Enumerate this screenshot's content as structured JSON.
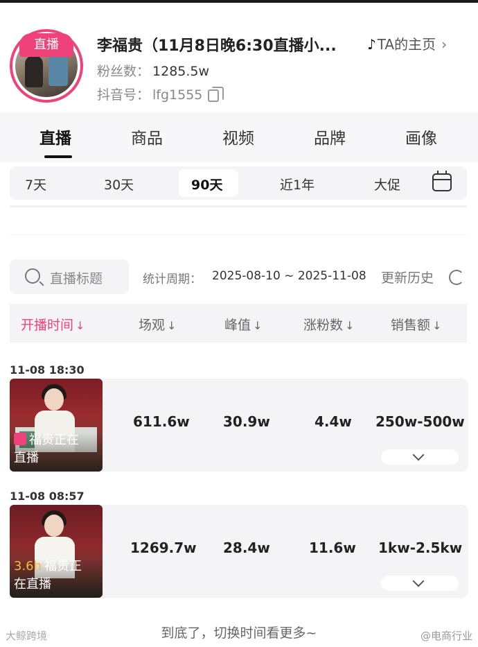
{
  "profile": {
    "live_badge": "直播",
    "name": "李福贵（11月8日晚6:30直播小...",
    "homepage_label": "TA的主页",
    "fans_label": "粉丝数：",
    "fans_value": "1285.5w",
    "douyin_id_label": "抖音号：",
    "douyin_id_value": "lfg1555"
  },
  "tabs": [
    "直播",
    "商品",
    "视频",
    "品牌",
    "画像"
  ],
  "active_tab": "直播",
  "periods": [
    "7天",
    "30天",
    "90天",
    "近1年",
    "大促"
  ],
  "active_period": "90天",
  "search": {
    "placeholder": "直播标题"
  },
  "stat": {
    "label": "统计周期：",
    "range": "2025-08-10 ~ 2025-11-08",
    "history": "更新历史"
  },
  "columns": [
    "开播时间",
    "场观",
    "峰值",
    "涨粉数",
    "销售额"
  ],
  "sort_arrow": "↓",
  "rows": [
    {
      "time": "11-08 18:30",
      "thumb_text_1": "福贵正在",
      "thumb_text_2": "直播",
      "duration": "",
      "views": "611.6w",
      "peak": "30.9w",
      "fans_gain": "4.4w",
      "sales": "250w-500w"
    },
    {
      "time": "11-08 08:57",
      "thumb_text_1": "福贵正",
      "thumb_text_2": "在直播",
      "duration": "3.6h",
      "views": "1269.7w",
      "peak": "28.4w",
      "fans_gain": "11.6w",
      "sales": "1kw-2.5kw"
    }
  ],
  "footer": "到底了，切换时间看更多~",
  "watermark_left": "大鲸跨境",
  "watermark_right": "@电商行业",
  "colors": {
    "accent": "#f0427a",
    "panel": "#f4f4f6",
    "text": "#222222",
    "muted": "#888888"
  }
}
